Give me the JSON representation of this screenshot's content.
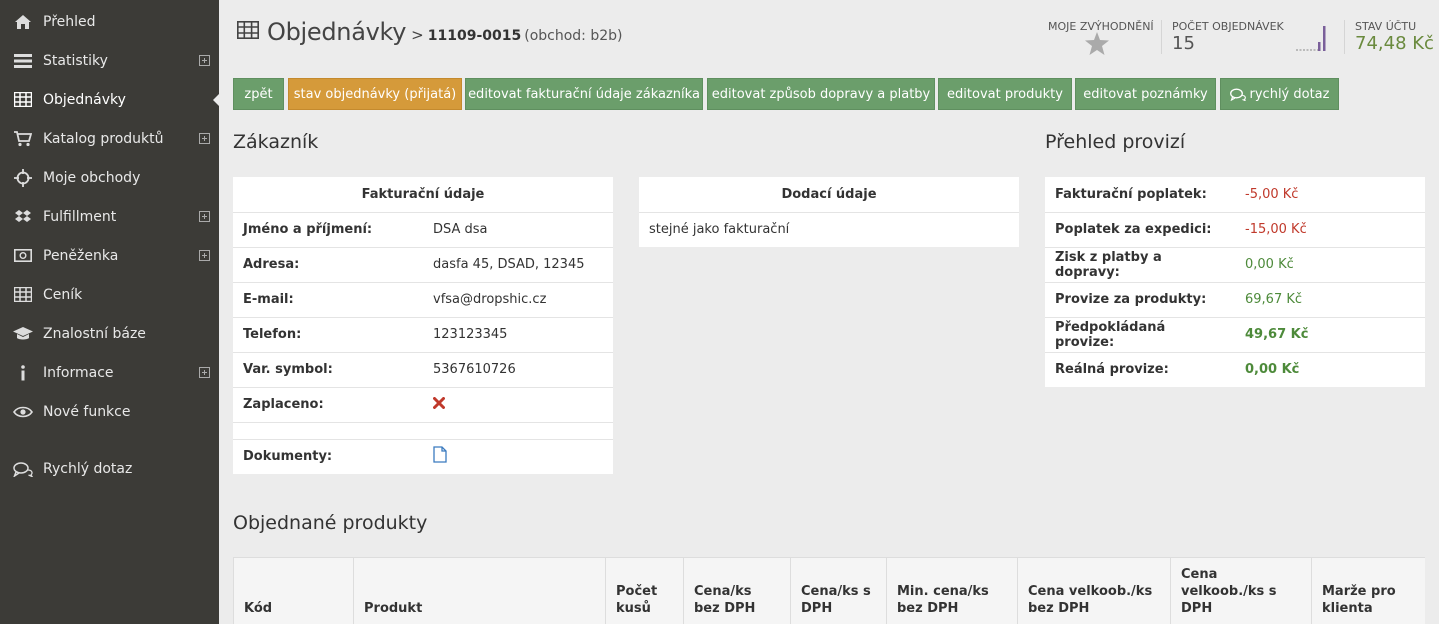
{
  "sidebar": {
    "items": [
      {
        "label": "Přehled",
        "icon": "home-icon"
      },
      {
        "label": "Statistiky",
        "icon": "bars-icon",
        "expand": true
      },
      {
        "label": "Objednávky",
        "icon": "table-icon",
        "active": true
      },
      {
        "label": "Katalog produktů",
        "icon": "cart-icon",
        "expand": true
      },
      {
        "label": "Moje obchody",
        "icon": "crosshair-icon"
      },
      {
        "label": "Fulfillment",
        "icon": "dropbox-icon",
        "expand": true
      },
      {
        "label": "Peněženka",
        "icon": "money-icon",
        "expand": true
      },
      {
        "label": "Ceník",
        "icon": "table-icon"
      },
      {
        "label": "Znalostní báze",
        "icon": "graduation-cap-icon"
      },
      {
        "label": "Informace",
        "icon": "info-icon",
        "expand": true
      },
      {
        "label": "Nové funkce",
        "icon": "eye-icon"
      },
      {
        "label": "Rychlý dotaz",
        "icon": "chat-icon"
      }
    ]
  },
  "header": {
    "title": "Objednávky",
    "separator": ">",
    "order_number": "11109-0015",
    "shop": "(obchod: b2b)"
  },
  "stats": {
    "favorites_caption": "Moje zvýhodnění",
    "orders_caption": "Počet objednávek",
    "orders_value": "15",
    "balance_caption": "Stav účtu",
    "balance_value": "74,48 Kč"
  },
  "toolbar": {
    "back": "zpět",
    "status": "stav objednávky (přijatá)",
    "edit_billing": "editovat fakturační údaje zákazníka",
    "edit_shipping": "editovat způsob dopravy a platby",
    "edit_products": "editovat produkty",
    "edit_notes": "editovat poznámky",
    "quick_question": "rychlý dotaz"
  },
  "customer": {
    "heading": "Zákazník",
    "billing_title": "Fakturační údaje",
    "rows": [
      {
        "key": "Jméno a příjmení:",
        "value": "DSA dsa"
      },
      {
        "key": "Adresa:",
        "value": "dasfa 45, DSAD, 12345"
      },
      {
        "key": "E-mail:",
        "value": "vfsa@dropshic.cz"
      },
      {
        "key": "Telefon:",
        "value": "123123345"
      },
      {
        "key": "Var. symbol:",
        "value": "5367610726"
      }
    ],
    "paid_label": "Zaplaceno:",
    "documents_label": "Dokumenty:",
    "delivery_title": "Dodací údaje",
    "delivery_value": "stejné jako fakturační"
  },
  "commissions": {
    "heading": "Přehled provizí",
    "rows": [
      {
        "key": "Fakturační poplatek:",
        "value": "-5,00 Kč"
      },
      {
        "key": "Poplatek za expedici:",
        "value": "-15,00 Kč"
      },
      {
        "key": "Zisk z platby a dopravy:",
        "value": "0,00 Kč"
      },
      {
        "key": "Provize za produkty:",
        "value": "69,67 Kč"
      },
      {
        "key": "Předpokládaná provize:",
        "value": "49,67 Kč"
      },
      {
        "key": "Reálná provize:",
        "value": "0,00 Kč"
      }
    ]
  },
  "products": {
    "heading": "Objednané produkty",
    "columns": [
      "Kód",
      "Produkt",
      "Počet kusů",
      "Cena/ks bez DPH",
      "Cena/ks s DPH",
      "Min. cena/ks bez DPH",
      "Cena velkoob./ks bez DPH",
      "Cena velkoob./ks s DPH",
      "Marže pro klienta"
    ]
  },
  "colors": {
    "sidebar_bg": "#3c3b37",
    "button_green": "#6b9e6b",
    "button_orange": "#d59a3a",
    "negative": "#c0392b",
    "positive": "#4d8a3a"
  }
}
